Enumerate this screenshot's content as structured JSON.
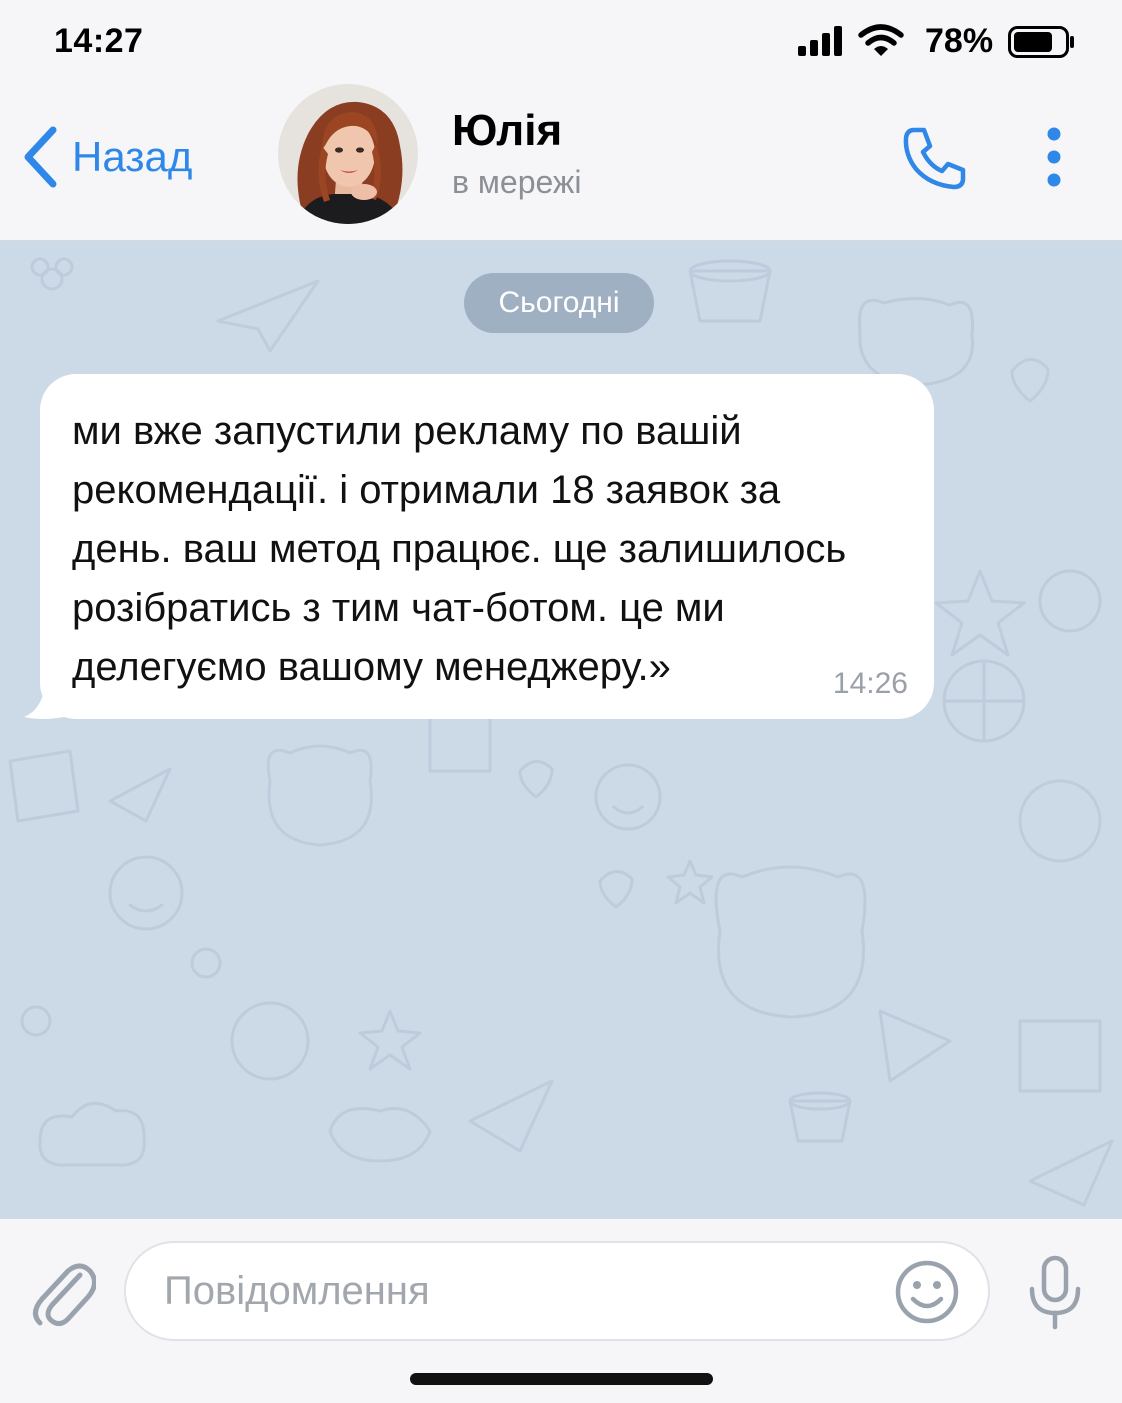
{
  "status_bar": {
    "time": "14:27",
    "battery_percent": "78%",
    "battery_level": 0.78
  },
  "header": {
    "back_label": "Назад",
    "contact_name": "Юлія",
    "contact_status": "в мережі"
  },
  "chat": {
    "date_label": "Сьогодні",
    "messages": [
      {
        "text": "ми вже запустили рекламу по вашій\nрекомендації. і отримали 18 заявок за\nдень. ваш метод працює. ще залишилось\nрозібратись з тим чат-ботом. це ми\nделегуємо вашому менеджеру.»",
        "time": "14:26",
        "direction": "incoming"
      }
    ]
  },
  "input": {
    "placeholder": "Повідомлення"
  },
  "colors": {
    "accent": "#2f88e8",
    "chat_background": "#ccd9e7",
    "bubble": "#ffffff",
    "muted_text": "#8b8f96"
  },
  "icons": {
    "back": "chevron-left-icon",
    "call": "phone-icon",
    "more": "more-vertical-icon",
    "attach": "paperclip-icon",
    "emoji": "emoji-icon",
    "mic": "microphone-icon"
  }
}
